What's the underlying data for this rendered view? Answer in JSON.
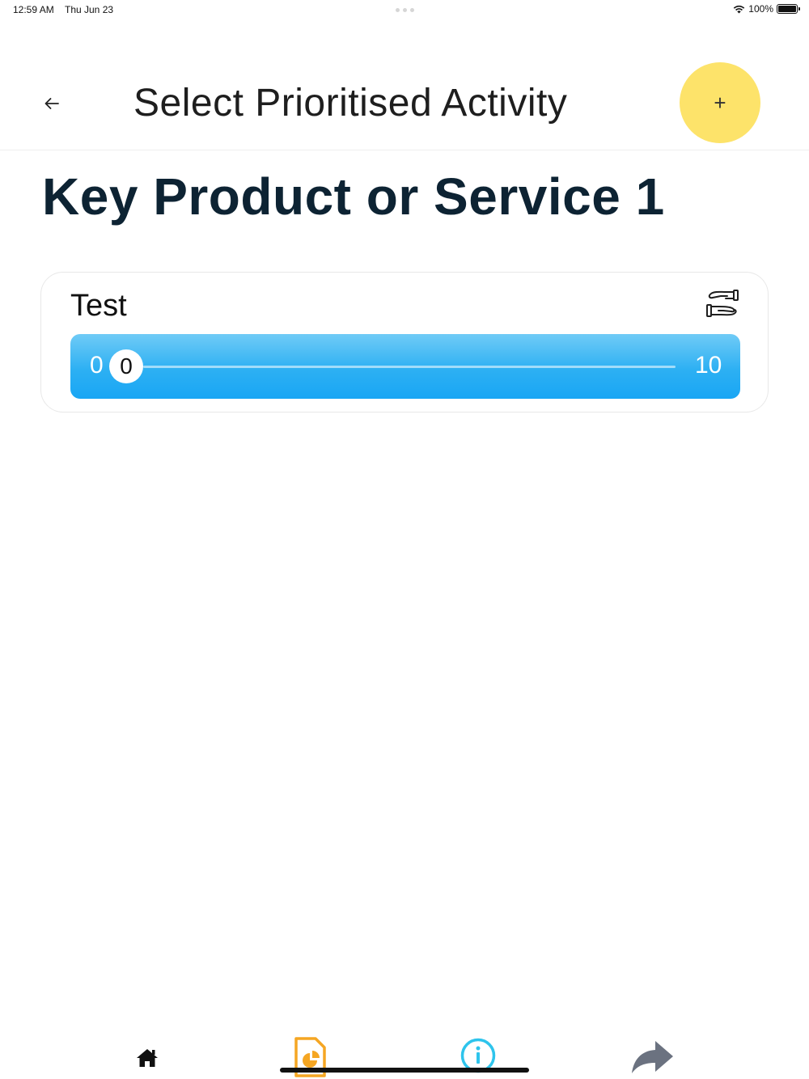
{
  "status_bar": {
    "time": "12:59 AM",
    "date": "Thu Jun 23",
    "battery": "100%"
  },
  "header": {
    "title": "Select Prioritised Activity",
    "back_icon": "arrow-left-icon",
    "add_label": "+"
  },
  "page": {
    "title": "Key Product or Service 1"
  },
  "activity": {
    "name": "Test",
    "icon": "handshake-icon",
    "slider": {
      "min": "0",
      "value": "0",
      "max": "10"
    }
  },
  "bottom_nav": {
    "items": [
      {
        "icon": "home-icon",
        "color": "#111111"
      },
      {
        "icon": "report-icon",
        "color": "#f5a623"
      },
      {
        "icon": "info-icon",
        "color": "#2ec4ec"
      },
      {
        "icon": "share-icon",
        "color": "#6b7280"
      }
    ]
  },
  "colors": {
    "accent_yellow": "#fde36a",
    "slider_blue": "#19a6f4",
    "title_navy": "#0d2333"
  }
}
